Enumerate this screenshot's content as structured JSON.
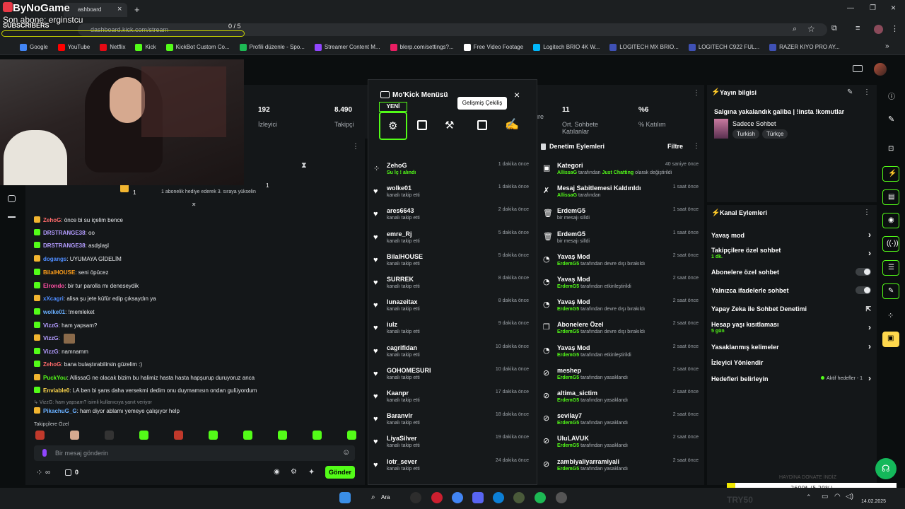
{
  "overlay": {
    "brand": "ByNoGame",
    "last_sub_label": "Son abone: erginstcu",
    "subscribers_label": "SUBSCRIBERS",
    "sub_progress": "0 / 5"
  },
  "browser": {
    "tab_title": "ashboard",
    "url": "dashboard.kick.com/stream",
    "bookmarks": [
      {
        "label": "Google",
        "color": "#4285f4"
      },
      {
        "label": "YouTube",
        "color": "#ff0000"
      },
      {
        "label": "Netflix",
        "color": "#e50914"
      },
      {
        "label": "Kick",
        "color": "#53fc18"
      },
      {
        "label": "KickBot Custom Co...",
        "color": "#53fc18"
      },
      {
        "label": "Profili düzenle - Spo...",
        "color": "#1db954"
      },
      {
        "label": "Streamer Content M...",
        "color": "#9146ff"
      },
      {
        "label": "blerp.com/settings?...",
        "color": "#e91e63"
      },
      {
        "label": "Free Video Footage",
        "color": "#ffffff"
      },
      {
        "label": "Logitech BRIO 4K W...",
        "color": "#00b8fc"
      },
      {
        "label": "LOGITECH MX BRIO...",
        "color": "#3f51b5"
      },
      {
        "label": "LOGITECH C922 FUL...",
        "color": "#3f51b5"
      },
      {
        "label": "RAZER KIYO PRO AY...",
        "color": "#3f51b5"
      }
    ]
  },
  "stats": [
    {
      "value": "192",
      "label": "İzleyici"
    },
    {
      "value": "8.490",
      "label": "Takipçi"
    },
    {
      "value": "",
      "label": "üre"
    },
    {
      "value": "11",
      "label": "Ort. Sohbete Katılanlar"
    },
    {
      "value": "%6",
      "label": "% Katılım"
    }
  ],
  "mokick": {
    "title": "Mo'Kick Menüsü",
    "new_badge": "YENİ",
    "tooltip": "Gelişmiş Çekiliş",
    "events": [
      {
        "name": "ZehoG",
        "sub": "Su İç ! alındı",
        "time": "1 dakika önce",
        "type": "redeem"
      },
      {
        "name": "wolke01",
        "sub": "kanalı takip etti",
        "time": "1 dakika önce",
        "type": "follow"
      },
      {
        "name": "ares6643",
        "sub": "kanalı takip etti",
        "time": "2 dakika önce",
        "type": "follow"
      },
      {
        "name": "emre_Rj",
        "sub": "kanalı takip etti",
        "time": "5 dakika önce",
        "type": "follow"
      },
      {
        "name": "BilalHOUSE",
        "sub": "kanalı takip etti",
        "time": "5 dakika önce",
        "type": "follow"
      },
      {
        "name": "SURREK",
        "sub": "kanalı takip etti",
        "time": "8 dakika önce",
        "type": "follow"
      },
      {
        "name": "lunazeitax",
        "sub": "kanalı takip etti",
        "time": "8 dakika önce",
        "type": "follow"
      },
      {
        "name": "iulz",
        "sub": "kanalı takip etti",
        "time": "9 dakika önce",
        "type": "follow"
      },
      {
        "name": "cagrifidan",
        "sub": "kanalı takip etti",
        "time": "10 dakika önce",
        "type": "follow"
      },
      {
        "name": "GOHOMESURI",
        "sub": "kanalı takip etti",
        "time": "10 dakika önce",
        "type": "follow"
      },
      {
        "name": "Kaanpr",
        "sub": "kanalı takip etti",
        "time": "17 dakika önce",
        "type": "follow"
      },
      {
        "name": "Baranvlr",
        "sub": "kanalı takip etti",
        "time": "18 dakika önce",
        "type": "follow"
      },
      {
        "name": "LiyaSilver",
        "sub": "kanalı takip etti",
        "time": "19 dakika önce",
        "type": "follow"
      },
      {
        "name": "lotr_sever",
        "sub": "kanalı takip etti",
        "time": "24 dakika önce",
        "type": "follow"
      }
    ]
  },
  "moderation": {
    "title": "Denetim Eylemleri",
    "filter_label": "Filtre",
    "items": [
      {
        "title": "Kategori",
        "actor": "AllissaG",
        "mid": " tarafından ",
        "extra": "Just Chatting",
        "rest": " olarak değiştirildi",
        "time": "40 saniye önce",
        "icon": "category"
      },
      {
        "title": "Mesaj Sabitlemesi Kaldırıldı",
        "actor": "AllissaG",
        "mid": " tarafından",
        "extra": "",
        "rest": "",
        "time": "1 saat önce",
        "icon": "unpin"
      },
      {
        "title": "ErdemG5",
        "actor": "",
        "mid": "bir mesajı silldi",
        "extra": "",
        "rest": "",
        "time": "1 saat önce",
        "icon": "trash"
      },
      {
        "title": "ErdemG5",
        "actor": "",
        "mid": "bir mesajı silldi",
        "extra": "",
        "rest": "",
        "time": "1 saat önce",
        "icon": "trash"
      },
      {
        "title": "Yavaş Mod",
        "actor": "ErdemG5",
        "mid": " tarafından devre dışı bırakıldı",
        "extra": "",
        "rest": "",
        "time": "2 saat önce",
        "icon": "slow"
      },
      {
        "title": "Yavaş Mod",
        "actor": "ErdemG5",
        "mid": " tarafından etkinleştirildi",
        "extra": "",
        "rest": "",
        "time": "2 saat önce",
        "icon": "slow"
      },
      {
        "title": "Yavaş Mod",
        "actor": "ErdemG5",
        "mid": " tarafından devre dışı bırakıldı",
        "extra": "",
        "rest": "",
        "time": "2 saat önce",
        "icon": "slow"
      },
      {
        "title": "Abonelere Özel",
        "actor": "ErdemG5",
        "mid": " tarafından devre dışı bırakıldı",
        "extra": "",
        "rest": "",
        "time": "2 saat önce",
        "icon": "gift"
      },
      {
        "title": "Yavaş Mod",
        "actor": "ErdemG5",
        "mid": " tarafından etkinleştirildi",
        "extra": "",
        "rest": "",
        "time": "2 saat önce",
        "icon": "slow"
      },
      {
        "title": "meshep",
        "actor": "ErdemG5",
        "mid": " tarafından yasaklandı",
        "extra": "",
        "rest": "",
        "time": "2 saat önce",
        "icon": "ban"
      },
      {
        "title": "altima_sictim",
        "actor": "ErdemG5",
        "mid": " tarafından yasaklandı",
        "extra": "",
        "rest": "",
        "time": "2 saat önce",
        "icon": "ban"
      },
      {
        "title": "sevilay7",
        "actor": "ErdemG5",
        "mid": " tarafından yasaklandı",
        "extra": "",
        "rest": "",
        "time": "2 saat önce",
        "icon": "ban"
      },
      {
        "title": "UluLAVUK",
        "actor": "ErdemG5",
        "mid": " tarafından yasaklandı",
        "extra": "",
        "rest": "",
        "time": "2 saat önce",
        "icon": "ban"
      },
      {
        "title": "zambiyaliyarramiyali",
        "actor": "ErdemG5",
        "mid": " tarafından yasaklandı",
        "extra": "",
        "rest": "",
        "time": "2 saat önce",
        "icon": "ban"
      }
    ]
  },
  "stream_info": {
    "heading": "Yayın bilgisi",
    "title": "Salgına yakalandık galiba | !insta !komutlar",
    "category": "Sadece Sohbet",
    "tags": [
      "Turkish",
      "Türkçe"
    ]
  },
  "channel_actions": {
    "heading": "Kanal Eylemleri",
    "items": [
      {
        "label": "Yavaş mod",
        "sub": "",
        "control": "chevron"
      },
      {
        "label": "Takipçilere özel sohbet",
        "sub": "1 dk.",
        "control": "chevron"
      },
      {
        "label": "Abonelere özel sohbet",
        "sub": "",
        "control": "toggle"
      },
      {
        "label": "Yalnızca ifadelerle sohbet",
        "sub": "",
        "control": "toggle"
      },
      {
        "label": "Yapay Zeka ile Sohbet Denetimi",
        "sub": "",
        "control": "external"
      },
      {
        "label": "Hesap yaşı kısıtlaması",
        "sub": "5 gün",
        "control": "chevron"
      },
      {
        "label": "Yasaklanmış kelimeler",
        "sub": "",
        "control": "chevron"
      },
      {
        "label": "İzleyici Yönlendir",
        "sub": "",
        "control": "none"
      },
      {
        "label": "Hedefleri belirleyin",
        "sub": "",
        "control": "goals"
      }
    ],
    "goals_status": "Aktif hedefler - 1"
  },
  "chat": {
    "pinned_count": "1",
    "pinned_text": "1 abonelik hediye ederek 3. sıraya yükselin",
    "messages": [
      {
        "user": "ZehoG",
        "color": "#ff6b6b",
        "text": ": önce bi su içelim bence"
      },
      {
        "user": "DRSTRANGE38",
        "color": "#b39cff",
        "text": ": oo"
      },
      {
        "user": "DRSTRANGE38",
        "color": "#b39cff",
        "text": ": asdşlaşl"
      },
      {
        "user": "dogangs",
        "color": "#4e8cff",
        "text": ": UYUMAYA GİDELİM"
      },
      {
        "user": "BilalHOUSE",
        "color": "#ff9f1a",
        "text": ": seni öpücez"
      },
      {
        "user": "Elrondo",
        "color": "#ff4fa3",
        "text": ": bir tur parolla mı deneseydik"
      },
      {
        "user": "xXcagri",
        "color": "#4e8cff",
        "text": ": alisa şu jete küfür edip çıksaydın ya"
      },
      {
        "user": "wolke01",
        "color": "#6ab0ff",
        "text": ": !memleket"
      },
      {
        "user": "VizzG",
        "color": "#b39cff",
        "text": ": ham yapsam?"
      },
      {
        "user": "VizzG",
        "color": "#b39cff",
        "text": ":"
      },
      {
        "user": "VizzG",
        "color": "#b39cff",
        "text": ": namnamm"
      },
      {
        "user": "ZehoG",
        "color": "#ff6b6b",
        "text": ": bana bulaştırabilirsin güzelim :)"
      },
      {
        "user": "PuckYou",
        "color": "#53fc18",
        "text": ": AllissaG ne olacak bizim bu halimiz hasta hasta hapşurup duruyoruz anca"
      },
      {
        "user": "Enviable0",
        "color": "#ffd84d",
        "text": ": LA ben bi şans daha versekmi dedim onu duymamısın ondan gulüyordum"
      },
      {
        "user": "",
        "color": "#8a8f94",
        "text": "↳ VizzG: ham yapsam? isimli kullanıcıya yanıt veriyor"
      },
      {
        "user": "PikachuG_G",
        "color": "#6ab0ff",
        "text": ": ham diyor ablamı yemeye çalışıyor help"
      }
    ],
    "followers_only_label": "Takipçilere Özel",
    "input_placeholder": "Bir mesaj gönderin",
    "send_label": "Gönder",
    "points": "0"
  },
  "donation": {
    "watermark": "HAYDİNA DONATE İNDİZ",
    "amount": "2600₺ (5.20%)",
    "progress_percent": 5.2,
    "code": "TRY50"
  },
  "taskbar": {
    "search_label": "Ara",
    "date": "14.02.2025"
  },
  "colors": {
    "accent": "#53fc18",
    "panel": "#141719",
    "background": "#0b0e0f"
  }
}
